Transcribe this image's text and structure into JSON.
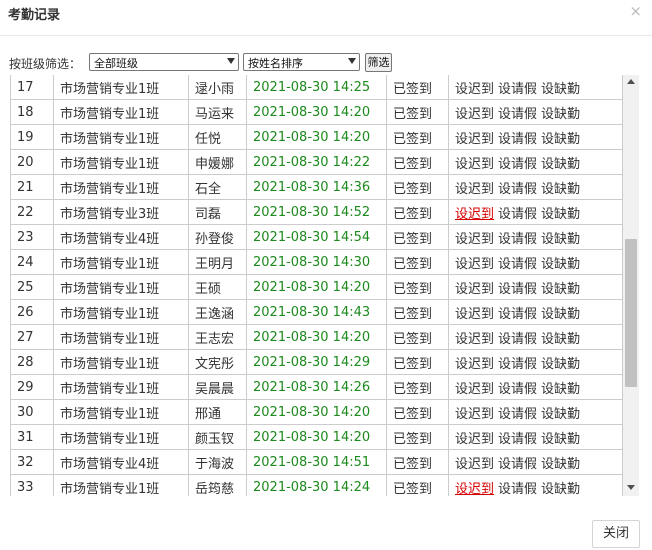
{
  "dialog": {
    "title": "考勤记录",
    "close_symbol": "×"
  },
  "filter": {
    "label": "按班级筛选：",
    "class_select": "全部班级",
    "sort_select": "按姓名排序",
    "button": "筛选"
  },
  "rows": [
    {
      "no": "17",
      "cls": "市场营销专业1班",
      "name": "逯小雨",
      "time": "2021-08-30 14:25",
      "status": "已签到",
      "late": "设迟到",
      "leave": "设请假",
      "absent": "设缺勤",
      "late_highlight": false
    },
    {
      "no": "18",
      "cls": "市场营销专业1班",
      "name": "马运来",
      "time": "2021-08-30 14:20",
      "status": "已签到",
      "late": "设迟到",
      "leave": "设请假",
      "absent": "设缺勤",
      "late_highlight": false
    },
    {
      "no": "19",
      "cls": "市场营销专业1班",
      "name": "任悦",
      "time": "2021-08-30 14:20",
      "status": "已签到",
      "late": "设迟到",
      "leave": "设请假",
      "absent": "设缺勤",
      "late_highlight": false
    },
    {
      "no": "20",
      "cls": "市场营销专业1班",
      "name": "申媛娜",
      "time": "2021-08-30 14:22",
      "status": "已签到",
      "late": "设迟到",
      "leave": "设请假",
      "absent": "设缺勤",
      "late_highlight": false
    },
    {
      "no": "21",
      "cls": "市场营销专业1班",
      "name": "石全",
      "time": "2021-08-30 14:36",
      "status": "已签到",
      "late": "设迟到",
      "leave": "设请假",
      "absent": "设缺勤",
      "late_highlight": false
    },
    {
      "no": "22",
      "cls": "市场营销专业3班",
      "name": "司磊",
      "time": "2021-08-30 14:52",
      "status": "已签到",
      "late": "设迟到",
      "leave": "设请假",
      "absent": "设缺勤",
      "late_highlight": true
    },
    {
      "no": "23",
      "cls": "市场营销专业4班",
      "name": "孙登俊",
      "time": "2021-08-30 14:54",
      "status": "已签到",
      "late": "设迟到",
      "leave": "设请假",
      "absent": "设缺勤",
      "late_highlight": false
    },
    {
      "no": "24",
      "cls": "市场营销专业1班",
      "name": "王明月",
      "time": "2021-08-30 14:30",
      "status": "已签到",
      "late": "设迟到",
      "leave": "设请假",
      "absent": "设缺勤",
      "late_highlight": false
    },
    {
      "no": "25",
      "cls": "市场营销专业1班",
      "name": "王硕",
      "time": "2021-08-30 14:20",
      "status": "已签到",
      "late": "设迟到",
      "leave": "设请假",
      "absent": "设缺勤",
      "late_highlight": false
    },
    {
      "no": "26",
      "cls": "市场营销专业1班",
      "name": "王逸涵",
      "time": "2021-08-30 14:43",
      "status": "已签到",
      "late": "设迟到",
      "leave": "设请假",
      "absent": "设缺勤",
      "late_highlight": false
    },
    {
      "no": "27",
      "cls": "市场营销专业1班",
      "name": "王志宏",
      "time": "2021-08-30 14:20",
      "status": "已签到",
      "late": "设迟到",
      "leave": "设请假",
      "absent": "设缺勤",
      "late_highlight": false
    },
    {
      "no": "28",
      "cls": "市场营销专业1班",
      "name": "文宪彤",
      "time": "2021-08-30 14:29",
      "status": "已签到",
      "late": "设迟到",
      "leave": "设请假",
      "absent": "设缺勤",
      "late_highlight": false
    },
    {
      "no": "29",
      "cls": "市场营销专业1班",
      "name": "吴晨晨",
      "time": "2021-08-30 14:26",
      "status": "已签到",
      "late": "设迟到",
      "leave": "设请假",
      "absent": "设缺勤",
      "late_highlight": false
    },
    {
      "no": "30",
      "cls": "市场营销专业1班",
      "name": "邢通",
      "time": "2021-08-30 14:20",
      "status": "已签到",
      "late": "设迟到",
      "leave": "设请假",
      "absent": "设缺勤",
      "late_highlight": false
    },
    {
      "no": "31",
      "cls": "市场营销专业1班",
      "name": "颜玉钗",
      "time": "2021-08-30 14:20",
      "status": "已签到",
      "late": "设迟到",
      "leave": "设请假",
      "absent": "设缺勤",
      "late_highlight": false
    },
    {
      "no": "32",
      "cls": "市场营销专业4班",
      "name": "于海波",
      "time": "2021-08-30 14:51",
      "status": "已签到",
      "late": "设迟到",
      "leave": "设请假",
      "absent": "设缺勤",
      "late_highlight": false
    },
    {
      "no": "33",
      "cls": "市场营销专业1班",
      "name": "岳筠慈",
      "time": "2021-08-30 14:24",
      "status": "已签到",
      "late": "设迟到",
      "leave": "设请假",
      "absent": "设缺勤",
      "late_highlight": true
    }
  ],
  "footer": {
    "close_button": "关闭"
  },
  "colors": {
    "time_green": "#1c8a1c",
    "late_red": "#d60000"
  }
}
